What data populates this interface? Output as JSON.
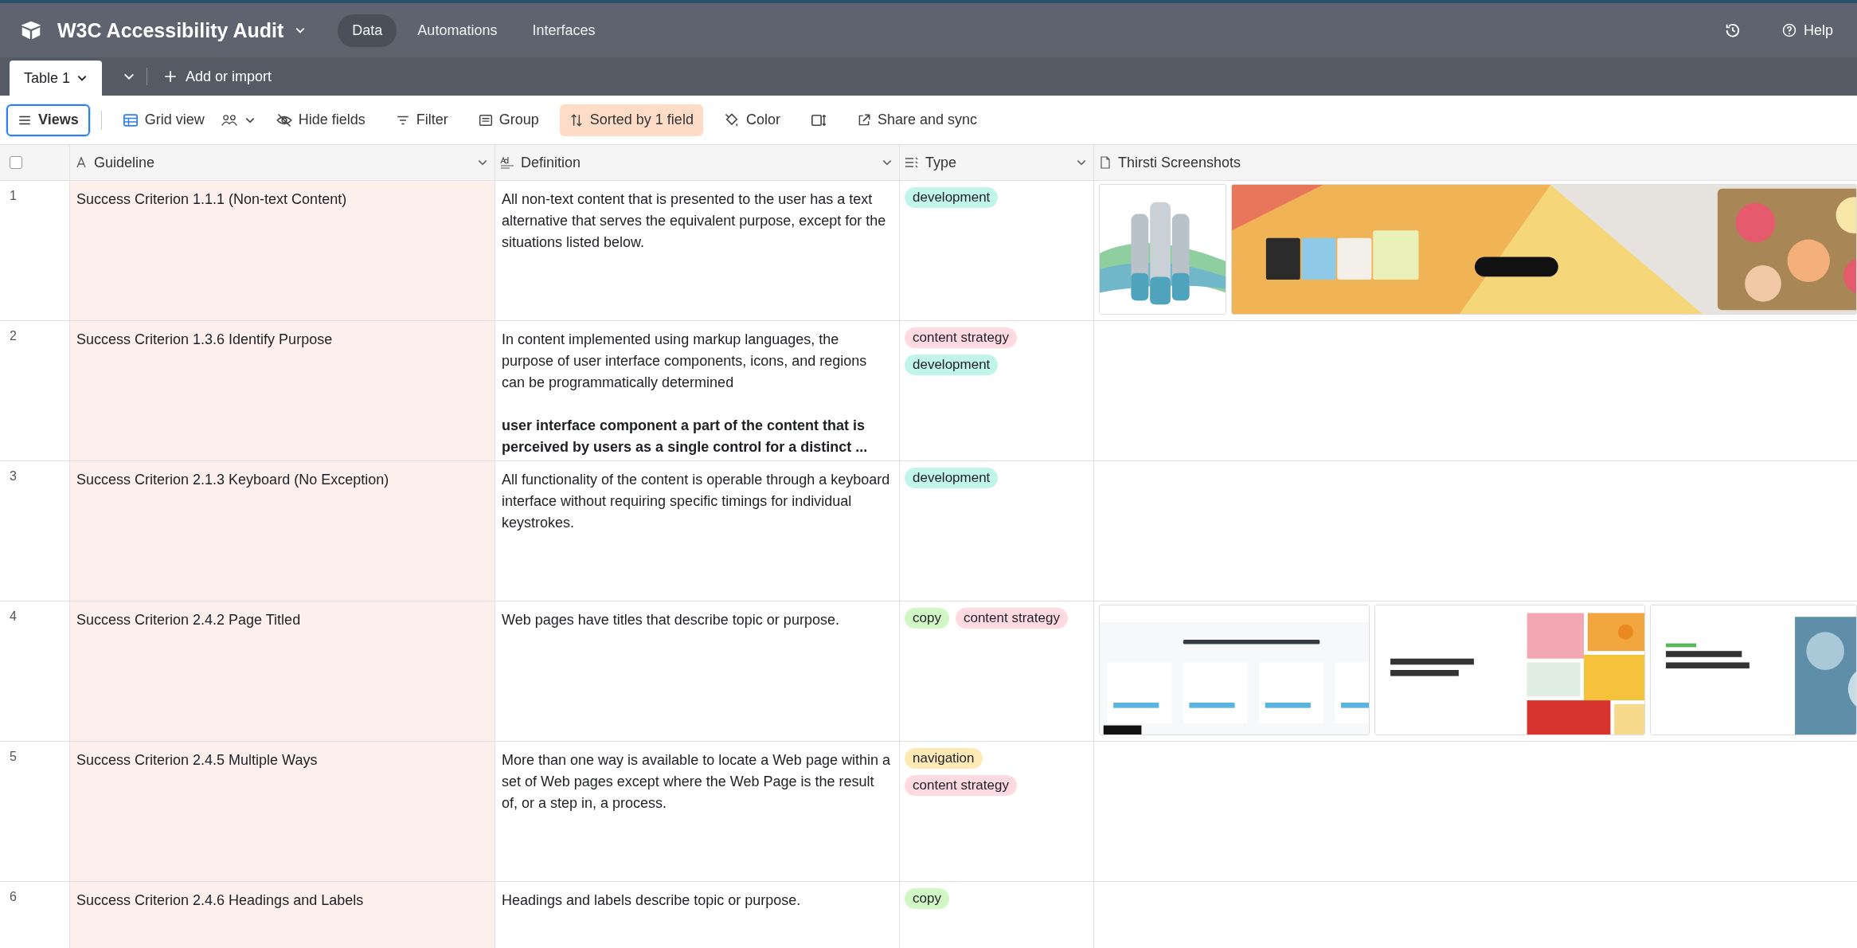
{
  "app_bar": {
    "title": "W3C Accessibility Audit",
    "tabs": [
      {
        "label": "Data",
        "selected": true
      },
      {
        "label": "Automations",
        "selected": false
      },
      {
        "label": "Interfaces",
        "selected": false
      }
    ],
    "help": "Help"
  },
  "table_tabs": {
    "tabs": [
      {
        "label": "Table 1",
        "selected": true
      }
    ],
    "add": "Add or import"
  },
  "toolbar": [
    {
      "kind": "views",
      "label": "Views",
      "active": false
    },
    {
      "kind": "grid",
      "label": "Grid view",
      "active": false
    },
    {
      "kind": "hide",
      "label": "Hide fields",
      "active": false
    },
    {
      "kind": "filter",
      "label": "Filter",
      "active": false
    },
    {
      "kind": "group",
      "label": "Group",
      "active": false
    },
    {
      "kind": "sort",
      "label": "Sorted by 1 field",
      "active": true
    },
    {
      "kind": "color",
      "label": "Color",
      "active": false
    },
    {
      "kind": "height",
      "active": false
    },
    {
      "kind": "share",
      "label": "Share and sync",
      "active": false
    }
  ],
  "table": {
    "select_all_checked": false,
    "columns": [
      {
        "kind": "text",
        "label": "Guideline"
      },
      {
        "kind": "longtext",
        "label": "Definition"
      },
      {
        "kind": "select",
        "label": "Type"
      },
      {
        "kind": "attachment",
        "label": "Thirsti Screenshots"
      }
    ],
    "rows": [
      {
        "number": "1",
        "guideline": "Success Criterion 1.1.1 (Non-text Content)",
        "definition": "All non-text content that is presented to the user has a text alternative that serves the equivalent purpose, except for the situations listed below.",
        "type": [
          {
            "label": "development",
            "color": "#c2f5e9"
          }
        ],
        "attachments": [
          {
            "kind": "picture"
          },
          {
            "kind": "picture"
          }
        ]
      },
      {
        "number": "2",
        "guideline": "Success Criterion 1.3.6 Identify Purpose",
        "definition": "In content implemented using markup languages, the purpose of user interface components, icons, and regions can be programmatically determined",
        "note": "user interface component a part of the content that is perceived by users as a single control for a distinct ...",
        "type": [
          {
            "label": "content strategy",
            "color": "#ffdae3"
          },
          {
            "label": "development",
            "color": "#c2f5e9"
          }
        ]
      },
      {
        "number": "3",
        "guideline": "Success Criterion 2.1.3 Keyboard (No Exception)",
        "definition": "All functionality of the content is operable through a keyboard interface without requiring specific timings for individual keystrokes.",
        "type": [
          {
            "label": "development",
            "color": "#c2f5e9"
          }
        ]
      },
      {
        "number": "4",
        "guideline": "Success Criterion 2.4.2 Page Titled",
        "definition": "Web pages have titles that describe topic or purpose.",
        "type": [
          {
            "label": "copy",
            "color": "#d1f7c4"
          },
          {
            "label": "content strategy",
            "color": "#ffdae3"
          }
        ],
        "attachments": [
          {
            "kind": "picture"
          },
          {
            "kind": "picture"
          },
          {
            "kind": "picture"
          }
        ]
      },
      {
        "number": "5",
        "guideline": "Success Criterion 2.4.5 Multiple Ways",
        "definition": "More than one way is available to locate a Web page within a set of Web pages except where the Web Page is the result of, or a step in, a process.",
        "type": [
          {
            "label": "navigation",
            "color": "#ffeab6"
          },
          {
            "label": "content strategy",
            "color": "#ffdae3"
          }
        ]
      },
      {
        "number": "6",
        "guideline": "Success Criterion 2.4.6 Headings and Labels",
        "definition": "Headings and labels describe topic or purpose.",
        "type": [
          {
            "label": "copy",
            "color": "#d1f7c4"
          }
        ]
      }
    ]
  }
}
